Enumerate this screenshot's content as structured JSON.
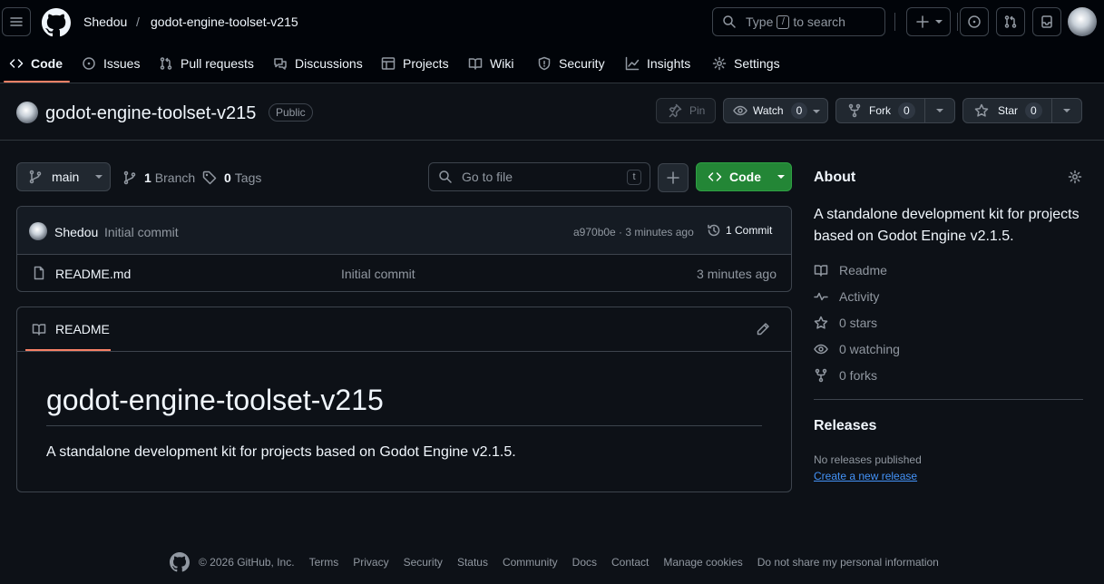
{
  "header": {
    "owner": "Shedou",
    "separator": "/",
    "repo": "godot-engine-toolset-v215",
    "search": {
      "prefix": "Type",
      "key": "/",
      "suffix": "to search"
    }
  },
  "nav": {
    "tabs": [
      {
        "label": "Code",
        "icon": "code-icon"
      },
      {
        "label": "Issues",
        "icon": "issue-opened-icon"
      },
      {
        "label": "Pull requests",
        "icon": "git-pull-request-icon"
      },
      {
        "label": "Discussions",
        "icon": "comment-discussion-icon"
      },
      {
        "label": "Projects",
        "icon": "table-icon"
      },
      {
        "label": "Wiki",
        "icon": "book-icon"
      },
      {
        "label": "Security",
        "icon": "shield-icon"
      },
      {
        "label": "Insights",
        "icon": "graph-icon"
      },
      {
        "label": "Settings",
        "icon": "gear-icon"
      }
    ],
    "selected": "Code"
  },
  "repo_head": {
    "title": "godot-engine-toolset-v215",
    "visibility": "Public",
    "pin_label": "Pin",
    "watch_label": "Watch",
    "watch_count": "0",
    "fork_label": "Fork",
    "fork_count": "0",
    "star_label": "Star",
    "star_count": "0"
  },
  "toolbar": {
    "branch": "main",
    "branch_count": "1",
    "branch_word": "Branch",
    "tag_count": "0",
    "tag_word": "Tags",
    "go_to_file": "Go to file",
    "go_to_file_key": "t",
    "code_label": "Code"
  },
  "commit": {
    "author": "Shedou",
    "message": "Initial commit",
    "hash_time": "a970b0e · 3 minutes ago",
    "commits_label": "1 Commit"
  },
  "files": [
    {
      "name": "README.md",
      "message": "Initial commit",
      "time": "3 minutes ago"
    }
  ],
  "readme": {
    "tab_label": "README",
    "heading": "godot-engine-toolset-v215",
    "body": "A standalone development kit for projects based on Godot Engine v2.1.5."
  },
  "about": {
    "title": "About",
    "description": "A standalone development kit for projects based on Godot Engine v2.1.5.",
    "links": [
      {
        "label": "Readme",
        "icon": "book-icon"
      },
      {
        "label": "Activity",
        "icon": "pulse-icon"
      },
      {
        "label": "0 stars",
        "icon": "star-icon"
      },
      {
        "label": "0 watching",
        "icon": "eye-icon"
      },
      {
        "label": "0 forks",
        "icon": "repo-forked-icon"
      }
    ]
  },
  "releases": {
    "title": "Releases",
    "none": "No releases published",
    "create_link": "Create a new release"
  },
  "footer": {
    "copyright": "© 2026 GitHub, Inc.",
    "links": [
      "Terms",
      "Privacy",
      "Security",
      "Status",
      "Community",
      "Docs",
      "Contact",
      "Manage cookies",
      "Do not share my personal information"
    ]
  },
  "colors": {
    "background": "#0d1117",
    "header_bg": "#010409",
    "accent_underline": "#f78166",
    "code_button": "#238636",
    "link": "#4493f8",
    "muted_text": "#9198a1"
  }
}
